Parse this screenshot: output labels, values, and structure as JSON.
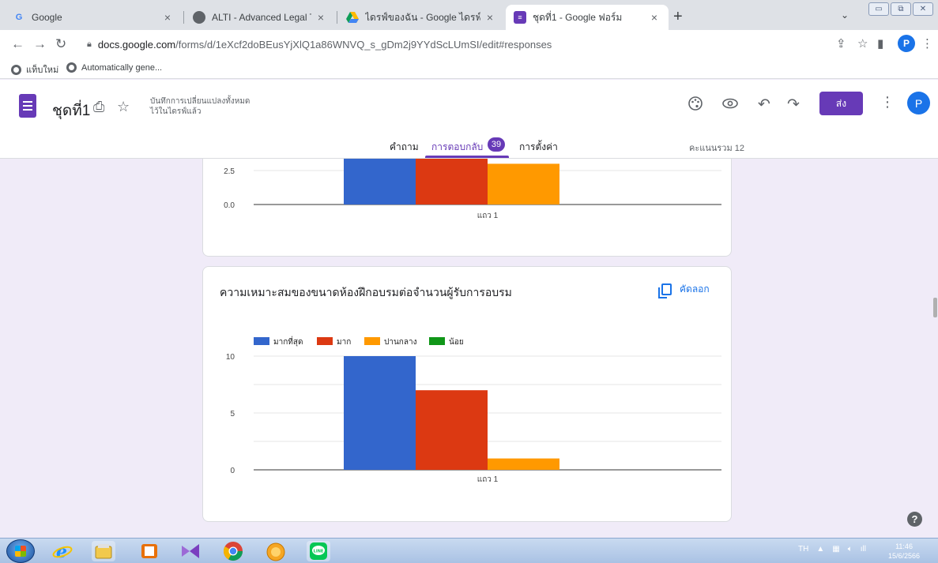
{
  "browser": {
    "tabs": [
      {
        "title": "Google",
        "favicon": "google-favicon"
      },
      {
        "title": "ALTI - Advanced Legal Training In",
        "favicon": "globe-icon"
      },
      {
        "title": "ไดรฟ์ของฉัน - Google ไดรฟ์",
        "favicon": "google-drive-icon"
      },
      {
        "title": "ชุดที่1 - Google ฟอร์ม",
        "favicon": "google-forms-icon"
      }
    ],
    "url_host": "docs.google.com",
    "url_path": "/forms/d/1eXcf2doBEusYjXlQ1a86WNVQ_s_gDm2j9YYdScLUmSI/edit#responses",
    "profile_initial": "P",
    "bookmarks": [
      "แท็บใหม่",
      "Automatically gene..."
    ]
  },
  "form": {
    "title": "ชุดที่1",
    "save_status_line1": "บันทึกการเปลี่ยนแปลงทั้งหมด",
    "save_status_line2": "ไว้ในไดรฟ์แล้ว",
    "send_label": "ส่ง",
    "avatar_initial": "P",
    "tabs": {
      "questions": "คำถาม",
      "responses": "การตอบกลับ",
      "settings": "การตั้งค่า"
    },
    "response_count": "39",
    "total_points": "คะแนนรวม 12"
  },
  "cards": {
    "card1": {
      "row_label": "แถว 1"
    },
    "card2": {
      "question": "ความเหมาะสมของขนาดห้องฝึกอบรมต่อจำนวนผู้รับการอบรม",
      "copy_label": "คัดลอก",
      "row_label": "แถว 1"
    }
  },
  "chart_data": [
    {
      "type": "bar",
      "categories": [
        "แถว 1"
      ],
      "series": [
        {
          "name": "มากที่สุด",
          "values": [
            null
          ]
        },
        {
          "name": "มาก",
          "values": [
            null
          ]
        },
        {
          "name": "ปานกลาง",
          "values": [
            3
          ]
        },
        {
          "name": "น้อย",
          "values": [
            0
          ]
        }
      ],
      "y_ticks": [
        "2.5",
        "0.0"
      ],
      "note": "partially scrolled out of view"
    },
    {
      "type": "bar",
      "categories": [
        "แถว 1"
      ],
      "series": [
        {
          "name": "มากที่สุด",
          "values": [
            10
          ]
        },
        {
          "name": "มาก",
          "values": [
            7
          ]
        },
        {
          "name": "ปานกลาง",
          "values": [
            1
          ]
        },
        {
          "name": "น้อย",
          "values": [
            0
          ]
        }
      ],
      "y_ticks": [
        "10",
        "5",
        "0"
      ],
      "ylim": [
        0,
        10
      ],
      "legend_position": "top-left",
      "grid": true
    }
  ],
  "colors": {
    "series": [
      "#3366cc",
      "#dc3912",
      "#ff9900",
      "#109618"
    ],
    "accent": "#673ab7",
    "page_bg": "#f0ebf8"
  },
  "taskbar": {
    "lang": "TH",
    "time": "11:46",
    "date": "15/6/2566",
    "apps": [
      "ie-icon",
      "explorer-icon",
      "media-icon",
      "visual-studio-icon",
      "chrome-icon",
      "app-icon",
      "line-icon"
    ]
  }
}
